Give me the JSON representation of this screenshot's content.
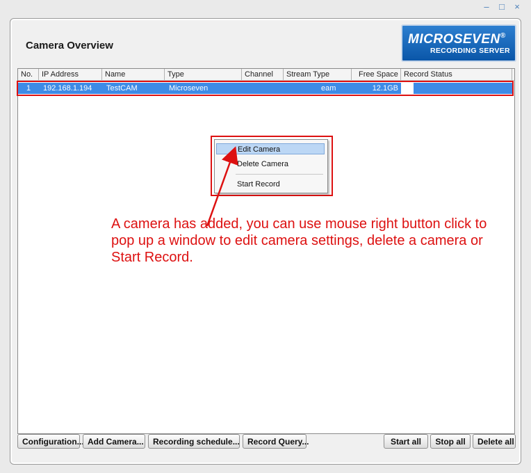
{
  "window": {
    "controls": {
      "minimize": "–",
      "maximize": "□",
      "close": "×"
    }
  },
  "header": {
    "title": "Camera Overview",
    "logo": {
      "brand": "MICROSEVEN",
      "reg": "®",
      "subtitle": "RECORDING SERVER"
    }
  },
  "table": {
    "columns": [
      "No.",
      "IP Address",
      "Name",
      "Type",
      "Channel",
      "Stream Type",
      "Free Space",
      "Record Status"
    ],
    "rows": [
      {
        "no": "1",
        "ip": "192.168.1.194",
        "name": "TestCAM",
        "type": "Microseven",
        "channel": "",
        "stream_type": "eam",
        "free_space": "12.1GB",
        "record_status": ""
      }
    ]
  },
  "context_menu": {
    "items": [
      {
        "label": "Edit Camera"
      },
      {
        "label": "Delete Camera"
      },
      {
        "label": "Start Record"
      }
    ]
  },
  "annotation": {
    "text": "A camera has added, you can use mouse right button click to pop up a window to edit camera settings, delete a camera or Start Record.",
    "color": "#dd1111"
  },
  "buttons": {
    "configuration": "Configuration...",
    "add_camera": "Add Camera...",
    "recording_schedule": "Recording schedule...",
    "record_query": "Record Query...",
    "start_all": "Start all",
    "stop_all": "Stop all",
    "delete_all": "Delete all"
  },
  "colors": {
    "selection": "#3d8be6",
    "highlight": "#dd1111",
    "logo_blue": "#0a56a8"
  }
}
